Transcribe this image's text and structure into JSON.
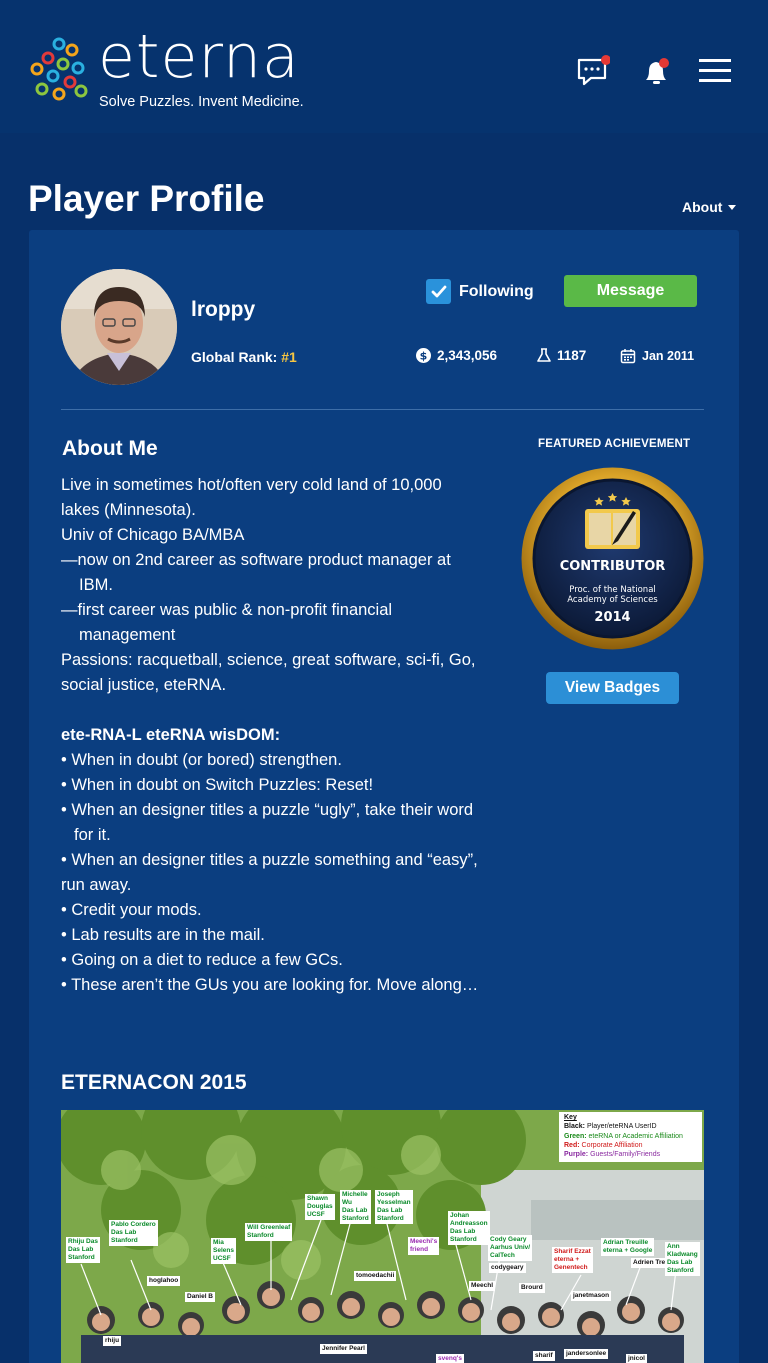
{
  "header": {
    "logo_word": "eterna",
    "logo_tagline": "Solve Puzzles. Invent Medicine.",
    "icons": [
      "chat-icon",
      "bell-icon",
      "menu-icon"
    ]
  },
  "page": {
    "title": "Player Profile",
    "about_dropdown": "About"
  },
  "profile": {
    "username": "lroppy",
    "rank_label": "Global Rank:",
    "rank_value": "#1",
    "following_label": "Following",
    "message_label": "Message",
    "points": "2,343,056",
    "labs": "1187",
    "joined": "Jan 2011"
  },
  "about": {
    "heading": "About Me",
    "lines": [
      "Live in sometimes hot/often very cold land of 10,000 lakes (Minnesota).",
      "Univ of Chicago BA/MBA",
      "—now on 2nd career as software product manager at IBM.",
      "—first career was public & non-profit financial management",
      "Passions: racquetball, science, great software, sci-fi, Go, social justice, eteRNA."
    ],
    "wisdom_title": "ete-RNA-L eteRNA wisDOM:",
    "wisdom": [
      "• When in doubt (or bored) strengthen.",
      "• When in doubt on Switch Puzzles: Reset!",
      "• When an designer titles a puzzle “ugly”, take their word for it.",
      "• When an designer titles a puzzle something and “easy”, run away.",
      "• Credit your mods.",
      "• Lab results are in the mail.",
      "• Going on a diet to reduce a few GCs.",
      "• These aren’t the GUs you are looking for. Move along…"
    ]
  },
  "achievement": {
    "label": "FEATURED ACHIEVEMENT",
    "badge_title": "CONTRIBUTOR",
    "badge_sub1": "Proc. of the National",
    "badge_sub2": "Academy of Sciences",
    "badge_year": "2014",
    "button": "View Badges"
  },
  "eternacon": {
    "heading": "ETERNACON 2015",
    "key_title": "Key",
    "key_rows": [
      [
        "Black:",
        "Player/eteRNA UserID"
      ],
      [
        "Green:",
        "eteRNA or Academic Affiliation"
      ],
      [
        "Red:",
        "Corporate Affiliation"
      ],
      [
        "Purple:",
        "Guests/Family/Friends"
      ]
    ],
    "tags": [
      "Rhiju Das\nDas Lab\nStanford",
      "Pablo Cordero\nDas Lab\nStanford",
      "Mia\nSelens\nUCSF",
      "Will Greenleaf\nStanford",
      "Shawn\nDouglas\nUCSF",
      "Michelle\nWu\nDas Lab\nStanford",
      "Joseph\nYesselman\nDas Lab\nStanford",
      "Meechi's\nfriend",
      "Johan\nAndreasson\nDas Lab\nStanford",
      "Cody Geary\nAarhus Univ/\nCalTech",
      "codygeary",
      "Sharif Ezzat\neterna +\nGenentech",
      "Adrian Treuille\neterna + Google",
      "Adrien Treuille",
      "Ann\nKladwang\nDas Lab\nStanford",
      "hoglahoo",
      "Daniel B",
      "tomoedachii",
      "Meechl",
      "Brourd",
      "janetmason",
      "rhiju",
      "Jennifer Pearl",
      "sharif",
      "jandersonlee",
      "jnicol",
      "svenq's"
    ]
  }
}
